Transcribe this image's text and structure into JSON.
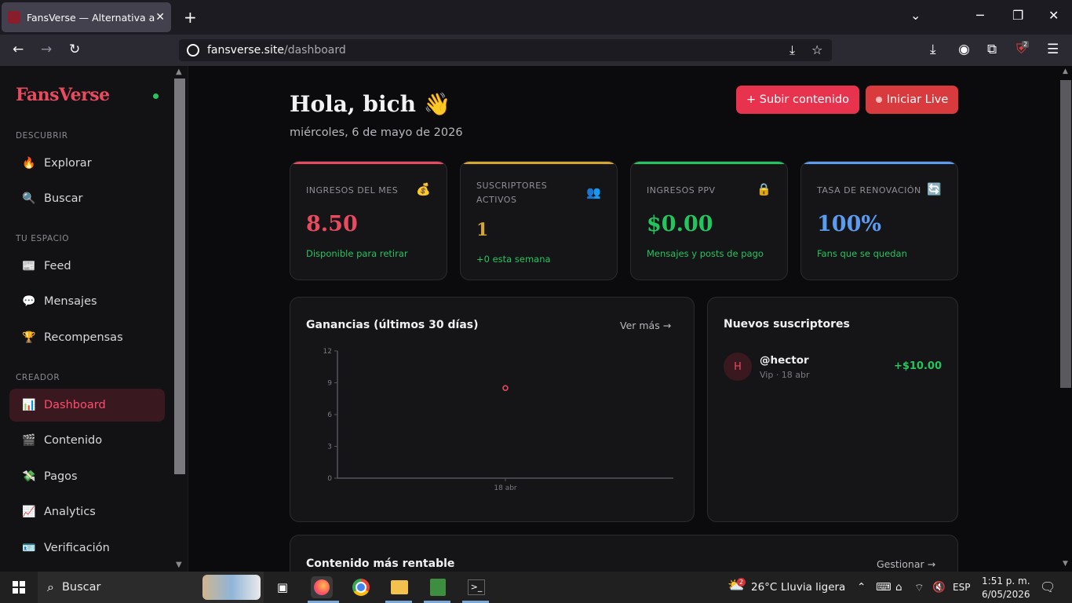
{
  "browser": {
    "tab_title": "FansVerse — Alternativa a OnlyF",
    "url_host": "fansverse.site",
    "url_path": "/dashboard",
    "ext_badge": "2"
  },
  "sidebar": {
    "brand": "FansVerse",
    "sections": {
      "discover": "DESCUBRIR",
      "space": "TU ESPACIO",
      "creator": "CREADOR"
    },
    "items": [
      {
        "label": "Explorar",
        "icon": "🔥"
      },
      {
        "label": "Buscar",
        "icon": "🔍"
      },
      {
        "label": "Feed",
        "icon": "📰"
      },
      {
        "label": "Mensajes",
        "icon": "💬"
      },
      {
        "label": "Recompensas",
        "icon": "🏆"
      },
      {
        "label": "Dashboard",
        "icon": "📊"
      },
      {
        "label": "Contenido",
        "icon": "🎬"
      },
      {
        "label": "Pagos",
        "icon": "💸"
      },
      {
        "label": "Analytics",
        "icon": "📈"
      },
      {
        "label": "Verificación",
        "icon": "🪪"
      }
    ]
  },
  "header": {
    "greeting": "Hola, bich 👋",
    "date": "miércoles, 6 de mayo de 2026",
    "upload_button": "+ Subir contenido",
    "live_button": "Iniciar Live"
  },
  "stats": [
    {
      "label": "INGRESOS DEL MES",
      "icon": "💰",
      "value": "8.50",
      "sub": "Disponible para retirar",
      "color": "#e84a5f",
      "bar": "#e84a5f"
    },
    {
      "label": "SUSCRIPTORES ACTIVOS",
      "icon": "👥",
      "value": "1",
      "sub": "+0 esta semana",
      "color": "#d4a72c",
      "bar": "#d4a72c"
    },
    {
      "label": "INGRESOS PPV",
      "icon": "🔒",
      "value": "$0.00",
      "sub": "Mensajes y posts de pago",
      "color": "#22c55e",
      "bar": "#22c55e"
    },
    {
      "label": "TASA DE RENOVACIÓN",
      "icon": "🔄",
      "value": "100%",
      "sub": "Fans que se quedan",
      "color": "#5b9cf0",
      "bar": "#5b9cf0"
    }
  ],
  "earnings_card": {
    "title": "Ganancias (últimos 30 días)",
    "link": "Ver más →"
  },
  "chart_data": {
    "type": "scatter",
    "title": "Ganancias (últimos 30 días)",
    "xlabel": "",
    "ylabel": "",
    "x": [
      "18 abr"
    ],
    "series": [
      {
        "values": [
          8.5
        ]
      }
    ],
    "ylim": [
      0,
      12
    ],
    "yticks": [
      0,
      3,
      6,
      9,
      12
    ],
    "grid": false,
    "color": "#e84a5f"
  },
  "subscribers_card": {
    "title": "Nuevos suscriptores",
    "entries": [
      {
        "initial": "H",
        "name": "@hector",
        "meta": "Vip · 18 abr",
        "amount": "+$10.00"
      }
    ]
  },
  "top_content_card": {
    "title": "Contenido más rentable",
    "link": "Gestionar →"
  },
  "taskbar": {
    "search": "Buscar",
    "weather_temp": "26°C",
    "weather_desc": "Lluvia ligera",
    "weather_badge": "2",
    "lang": "ESP",
    "time": "1:51 p. m.",
    "date": "6/05/2026"
  }
}
